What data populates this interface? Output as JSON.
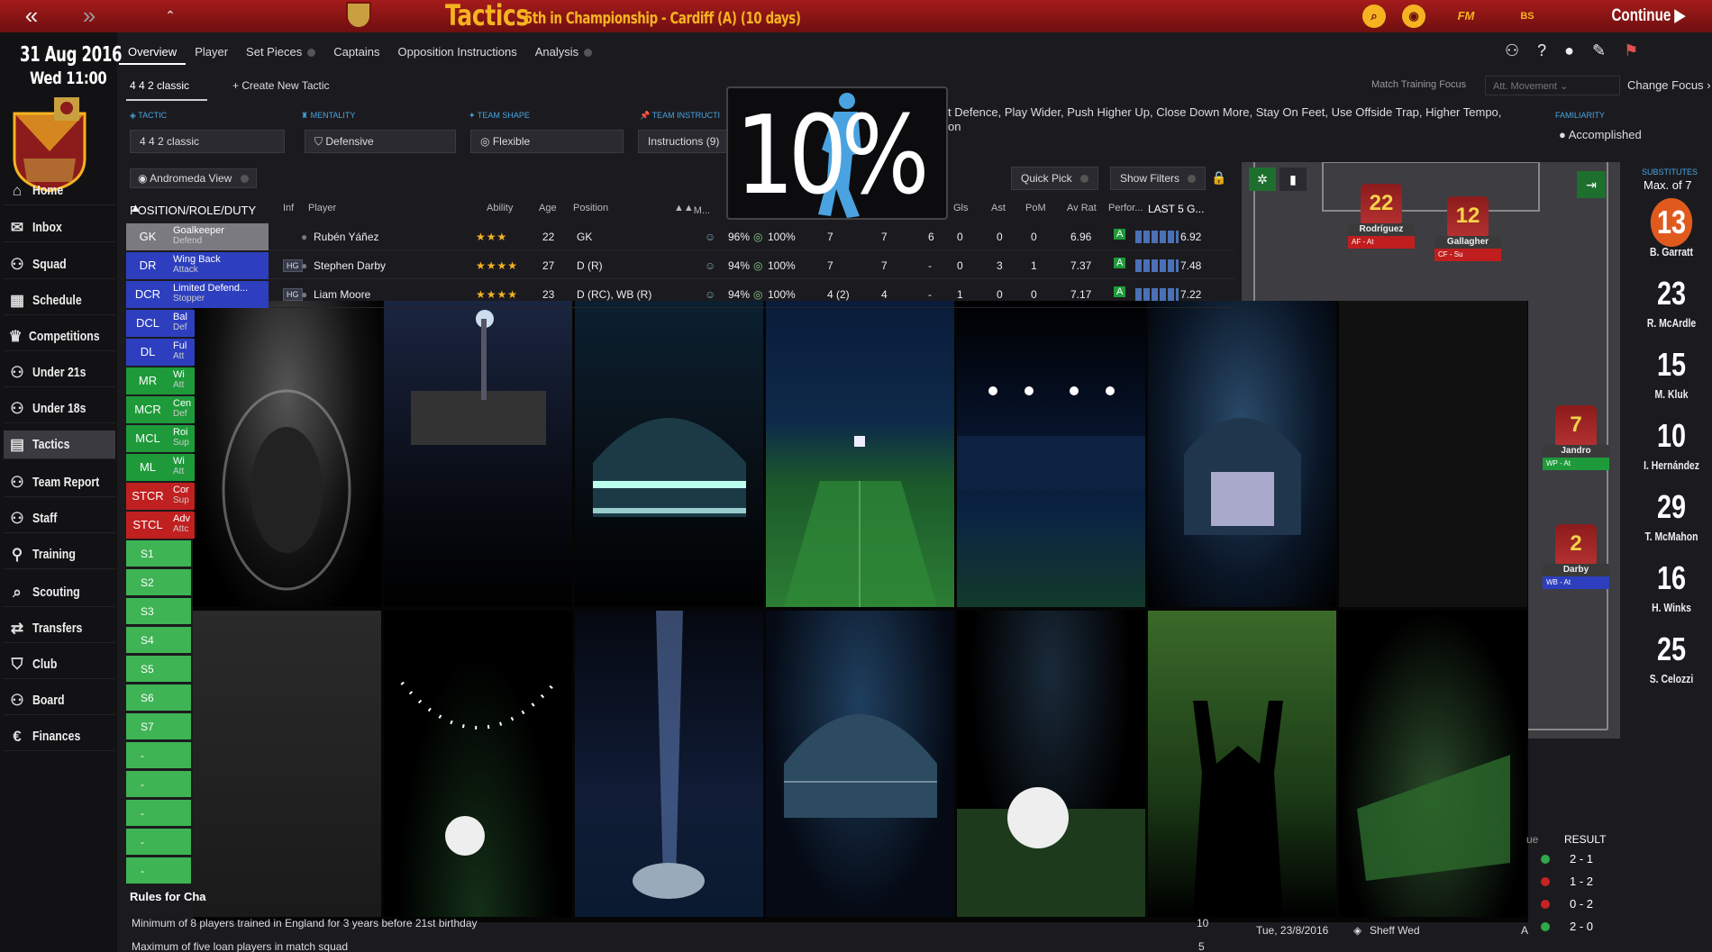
{
  "topbar": {
    "title": "Tactics",
    "subtitle": "5th in Championship - Cardiff (A) (10 days)",
    "continue_label": "Continue",
    "fm_label": "FM",
    "bs_label": "BS"
  },
  "sidebar": {
    "date": "31 Aug 2016",
    "time": "Wed 11:00",
    "items": [
      {
        "label": "Home",
        "icon": "home-icon"
      },
      {
        "label": "Inbox",
        "icon": "inbox-icon"
      },
      {
        "label": "Squad",
        "icon": "squad-icon"
      },
      {
        "label": "Schedule",
        "icon": "calendar-icon"
      },
      {
        "label": "Competitions",
        "icon": "trophy-icon"
      },
      {
        "label": "Under 21s",
        "icon": "u21-icon"
      },
      {
        "label": "Under 18s",
        "icon": "u18-icon"
      },
      {
        "label": "Tactics",
        "icon": "tactics-icon"
      },
      {
        "label": "Team Report",
        "icon": "team-report-icon"
      },
      {
        "label": "Staff",
        "icon": "staff-icon"
      },
      {
        "label": "Training",
        "icon": "training-icon"
      },
      {
        "label": "Scouting",
        "icon": "scouting-icon"
      },
      {
        "label": "Transfers",
        "icon": "transfers-icon"
      },
      {
        "label": "Club",
        "icon": "club-icon"
      },
      {
        "label": "Board",
        "icon": "board-icon"
      },
      {
        "label": "Finances",
        "icon": "finances-icon"
      }
    ]
  },
  "tabs": [
    "Overview",
    "Player",
    "Set Pieces",
    "Captains",
    "Opposition Instructions",
    "Analysis"
  ],
  "subbar": {
    "tactic_name": "4 4 2 classic",
    "create_new": "Create New Tactic",
    "match_training_focus": "Match Training Focus",
    "att_movement": "Att. Movement",
    "change_focus": "Change Focus"
  },
  "settings": {
    "tactic_label": "TACTIC",
    "tactic_value": "4 4 2 classic",
    "mentality_label": "MENTALITY",
    "mentality_value": "Defensive",
    "shape_label": "TEAM SHAPE",
    "shape_value": "Flexible",
    "instr_label": "TEAM INSTRUCTI",
    "instr_value": "Instructions (9)",
    "instr_text": "t Defence, Play Wider, Push Higher Up, Close Down More, Stay On Feet, Use Offside Trap, Higher Tempo,",
    "instr_text2": "on",
    "familiarity_label": "FAMILIARITY",
    "familiarity_value": "Accomplished"
  },
  "overlay": {
    "percent": "10%"
  },
  "toolbar": {
    "andromeda": "Andromeda View",
    "quick_pick": "Quick Pick",
    "show_filters": "Show Filters"
  },
  "table": {
    "headers": {
      "posrole": "POSITION/ROLE/DUTY",
      "inf": "Inf",
      "player": "Player",
      "ability": "Ability",
      "age": "Age",
      "position": "Position",
      "m": "M...",
      "gls": "Gls",
      "ast": "Ast",
      "pom": "PoM",
      "avrat": "Av Rat",
      "perf": "Perfor...",
      "last5": "LAST 5 G..."
    },
    "rows": [
      {
        "code": "GK",
        "role": "Goalkeeper",
        "duty": "Defend",
        "player": "Rubén Yáñez",
        "hg": "",
        "stars": "★★★",
        "age": "22",
        "position": "GK",
        "cond": "96%",
        "sharp": "100%",
        "apps": "7",
        "c2": "7",
        "c3": "6",
        "gls": "0",
        "ast": "0",
        "pom": "0",
        "avrat": "6.96",
        "perf": "A",
        "last5": "6.92",
        "color": "gk"
      },
      {
        "code": "DR",
        "role": "Wing Back",
        "duty": "Attack",
        "player": "Stephen Darby",
        "hg": "HG",
        "stars": "★★★★",
        "age": "27",
        "position": "D (R)",
        "cond": "94%",
        "sharp": "100%",
        "apps": "7",
        "c2": "7",
        "c3": "-",
        "gls": "0",
        "ast": "3",
        "pom": "1",
        "avrat": "7.37",
        "perf": "A",
        "last5": "7.48",
        "color": "def"
      },
      {
        "code": "DCR",
        "role": "Limited Defend...",
        "duty": "Stopper",
        "player": "Liam Moore",
        "hg": "HG",
        "stars": "★★★★",
        "age": "23",
        "position": "D (RC), WB (R)",
        "cond": "94%",
        "sharp": "100%",
        "apps": "4 (2)",
        "c2": "4",
        "c3": "-",
        "gls": "1",
        "ast": "0",
        "pom": "0",
        "avrat": "7.17",
        "perf": "A",
        "last5": "7.22",
        "color": "def"
      }
    ],
    "partial_rows": [
      {
        "code": "DCL",
        "role": "Bal",
        "duty": "Def",
        "color": "def"
      },
      {
        "code": "DL",
        "role": "Ful",
        "duty": "Att",
        "color": "def"
      },
      {
        "code": "MR",
        "role": "Wi",
        "duty": "Att",
        "color": "mid"
      },
      {
        "code": "MCR",
        "role": "Cen",
        "duty": "Def",
        "color": "mid"
      },
      {
        "code": "MCL",
        "role": "Roi",
        "duty": "Sup",
        "color": "mid"
      },
      {
        "code": "ML",
        "role": "Wi",
        "duty": "Att",
        "color": "mid"
      },
      {
        "code": "STCR",
        "role": "Cor",
        "duty": "Sup",
        "color": "att"
      },
      {
        "code": "STCL",
        "role": "Adv",
        "duty": "Attc",
        "color": "att"
      }
    ],
    "subs": [
      "S1",
      "S2",
      "S3",
      "S4",
      "S5",
      "S6",
      "S7",
      "-",
      "-",
      "-",
      "-",
      "-"
    ]
  },
  "pitch": {
    "players": [
      {
        "num": "22",
        "name": "Rodríguez",
        "role": "AF - At",
        "color": "#c01e1e"
      },
      {
        "num": "12",
        "name": "Gallagher",
        "role": "CF - Su",
        "color": "#c01e1e"
      },
      {
        "num": "7",
        "name": "Jandro",
        "role": "WP - At",
        "color": "#1e9a3a"
      },
      {
        "num": "2",
        "name": "Darby",
        "role": "WB - At",
        "color": "#2d3fbf"
      }
    ]
  },
  "subs": {
    "label": "SUBSTITUTES",
    "max": "Max. of 7",
    "players": [
      {
        "num": "13",
        "name": "B. Garratt"
      },
      {
        "num": "23",
        "name": "R. McArdle"
      },
      {
        "num": "15",
        "name": "M. Kluk"
      },
      {
        "num": "10",
        "name": "I. Hernández"
      },
      {
        "num": "29",
        "name": "T. McMahon"
      },
      {
        "num": "16",
        "name": "H. Winks"
      },
      {
        "num": "25",
        "name": "S. Celozzi"
      }
    ]
  },
  "bottom": {
    "rules_title": "Rules for Cha",
    "rule1": "Minimum of 8 players trained in England for 3 years before 21st birthday",
    "rule2": "Maximum of five loan players in match squad",
    "rule1_count": "10",
    "rule2_count": "5"
  },
  "results": {
    "header": "RESULT",
    "header_prefix": "ue",
    "items": [
      {
        "score": "2 - 1",
        "color": "#2fa84a"
      },
      {
        "score": "1 - 2",
        "color": "#c82222"
      },
      {
        "score": "0 - 2",
        "color": "#c82222"
      },
      {
        "score": "2 - 0",
        "color": "#2fa84a"
      }
    ]
  },
  "fixture": {
    "date": "Tue, 23/8/2016",
    "opponent": "Sheff Wed",
    "venue": "A"
  }
}
